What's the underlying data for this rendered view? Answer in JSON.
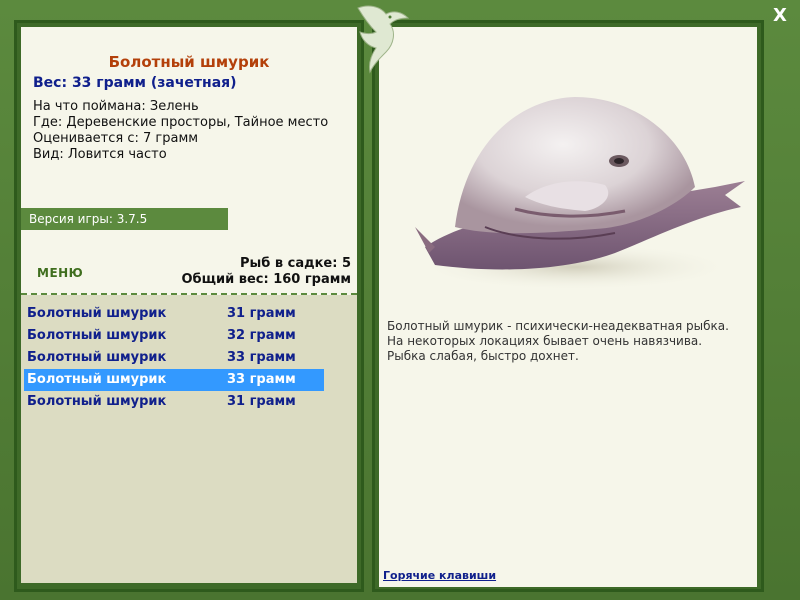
{
  "window": {
    "close_label": "X"
  },
  "fish": {
    "title": "Болотный шмурик",
    "weight_line": "Вес: 33 грамм (зачетная)",
    "info": [
      "На что поймана: Зелень",
      "Где: Деревенские просторы, Тайное место",
      "Оценивается с: 7 грамм",
      "Вид: Ловится часто"
    ],
    "description": "Болотный шмурик - психически-неадекватная рыбка.\nНа некоторых локациях бывает очень навязчива.\nРыбка слабая, быстро дохнет."
  },
  "version": "Версия игры: 3.7.5",
  "menu_label": "МЕНЮ",
  "cage": {
    "count_line": "Рыб в садке: 5",
    "total_line": "Общий вес: 160 грамм"
  },
  "catch_list": [
    {
      "name": "Болотный шмурик",
      "weight": "31 грамм",
      "selected": false
    },
    {
      "name": "Болотный шмурик",
      "weight": "32 грамм",
      "selected": false
    },
    {
      "name": "Болотный шмурик",
      "weight": "33 грамм",
      "selected": false
    },
    {
      "name": "Болотный шмурик",
      "weight": "33 грамм",
      "selected": true
    },
    {
      "name": "Болотный шмурик",
      "weight": "31 грамм",
      "selected": false
    }
  ],
  "hotkeys_label": "Горячие клавиши",
  "colors": {
    "frame": "#4e7a34",
    "panel_bg": "#f6f6ea",
    "list_bg": "#dcdcc2",
    "title": "#b3400a",
    "link": "#10208c",
    "selected": "#3399ff"
  }
}
